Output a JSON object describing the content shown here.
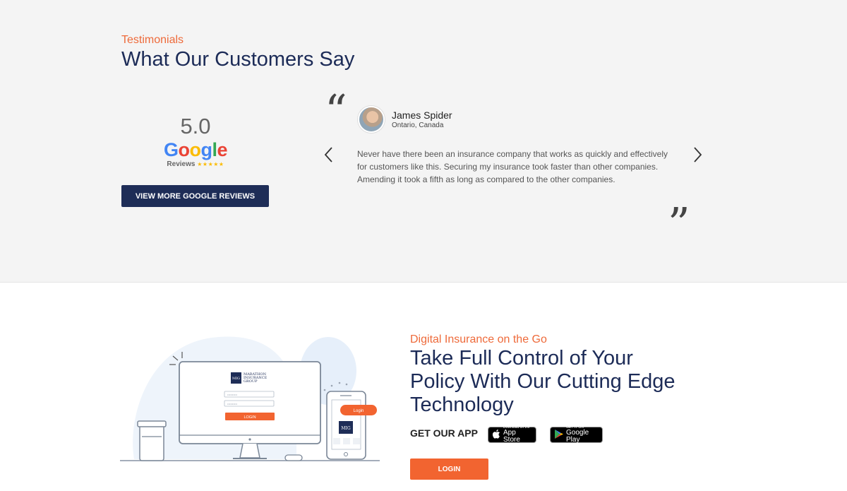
{
  "testimonials": {
    "eyebrow": "Testimonials",
    "title": "What Our Customers Say",
    "google": {
      "rating": "5.0",
      "logo_letters": [
        "G",
        "o",
        "o",
        "g",
        "l",
        "e"
      ],
      "reviews_label": "Reviews",
      "stars": "★★★★★"
    },
    "view_more_label": "VIEW MORE GOOGLE REVIEWS",
    "review": {
      "name": "James Spider",
      "location": "Ontario, Canada",
      "text": "Never have there been an insurance company that works as quickly and effectively for customers like this. Securing my insurance took faster than other companies. Amending it took a fifth as long as compared to the other companies."
    }
  },
  "app": {
    "eyebrow": "Digital Insurance on the Go",
    "title": "Take Full Control of Your Policy With Our Cutting Edge Technology",
    "get_app_label": "GET OUR APP",
    "app_store": {
      "small": "Download on the",
      "big": "App Store"
    },
    "google_play": {
      "small": "GET IT ON",
      "big": "Google Play"
    },
    "login_label": "LOGIN",
    "illustration": {
      "logo_mark": "MIG",
      "logo_lines": [
        "MARATHON",
        "INSURANCE",
        "GROUP"
      ],
      "field_placeholder": "••••••••••",
      "screen_login": "LOGIN",
      "phone_login": "Login",
      "phone_logo": "MIG"
    }
  },
  "colors": {
    "accent_orange": "#f26430",
    "navy": "#1e2d57",
    "eyebrow": "#ee6a3a"
  }
}
